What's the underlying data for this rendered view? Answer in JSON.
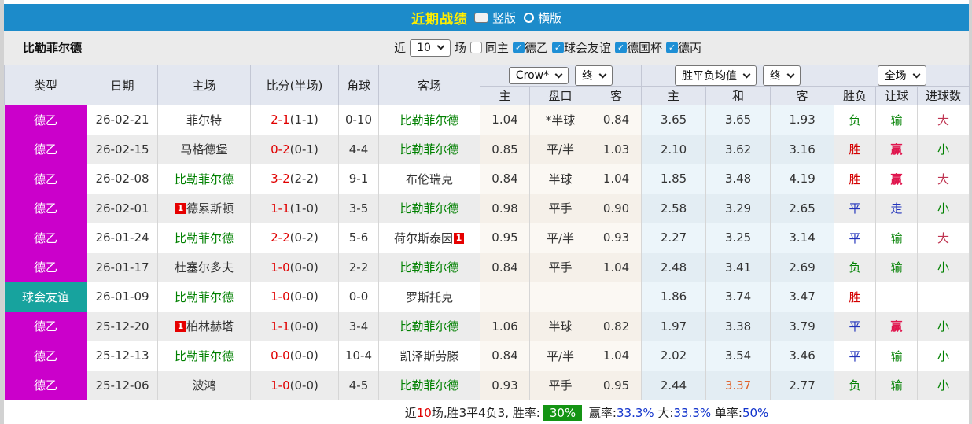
{
  "topbar": {
    "title": "近期战绩",
    "views": [
      {
        "label": "竖版",
        "selected": true
      },
      {
        "label": "横版",
        "selected": false
      }
    ]
  },
  "filterbar": {
    "team": "比勒菲尔德",
    "prefix": "近",
    "count": "10",
    "suffix": "场",
    "checkboxes": [
      {
        "label": "同主",
        "checked": false
      },
      {
        "label": "德乙",
        "checked": true
      },
      {
        "label": "球会友谊",
        "checked": true
      },
      {
        "label": "德国杯",
        "checked": true
      },
      {
        "label": "德丙",
        "checked": true
      }
    ]
  },
  "table": {
    "left_headers": [
      "类型",
      "日期",
      "主场",
      "比分(半场)",
      "角球",
      "客场"
    ],
    "odds_group": {
      "bookmaker": "Crow*",
      "period": "终",
      "cols": [
        "主",
        "盘口",
        "客"
      ]
    },
    "mean_group": {
      "label": "胜平负均值",
      "period": "终",
      "cols": [
        "主",
        "和",
        "客"
      ]
    },
    "result_group": {
      "scope": "全场",
      "cols": [
        "胜负",
        "让球",
        "进球数"
      ]
    },
    "badge_text": "1",
    "rows": [
      {
        "type": {
          "text": "德乙",
          "color": "#cb00cb"
        },
        "date": "26-02-21",
        "home": {
          "text": "菲尔特",
          "green": false,
          "badge": null
        },
        "score": [
          "2-1",
          "(1-1)"
        ],
        "corner": "0-10",
        "away": {
          "text": "比勒菲尔德",
          "green": true,
          "badge": null
        },
        "odds": [
          "1.04",
          "*半球",
          "0.84"
        ],
        "mean": [
          "3.65",
          "3.65",
          "1.93"
        ],
        "mean_hl": null,
        "outcome": {
          "t": "负",
          "c": "green"
        },
        "handicap": {
          "t": "输",
          "c": "green"
        },
        "goals": {
          "t": "大",
          "c": "rose"
        }
      },
      {
        "type": {
          "text": "德乙",
          "color": "#cb00cb"
        },
        "date": "26-02-15",
        "home": {
          "text": "马格德堡",
          "green": false,
          "badge": null
        },
        "score": [
          "0-2",
          "(0-1)"
        ],
        "corner": "4-4",
        "away": {
          "text": "比勒菲尔德",
          "green": true,
          "badge": null
        },
        "odds": [
          "0.85",
          "平/半",
          "1.03"
        ],
        "mean": [
          "2.10",
          "3.62",
          "3.16"
        ],
        "mean_hl": null,
        "outcome": {
          "t": "胜",
          "c": "red"
        },
        "handicap": {
          "t": "赢",
          "c": "crimson"
        },
        "goals": {
          "t": "小",
          "c": "green"
        }
      },
      {
        "type": {
          "text": "德乙",
          "color": "#cb00cb"
        },
        "date": "26-02-08",
        "home": {
          "text": "比勒菲尔德",
          "green": true,
          "badge": null
        },
        "score": [
          "3-2",
          "(2-2)"
        ],
        "corner": "9-1",
        "away": {
          "text": "布伦瑞克",
          "green": false,
          "badge": null
        },
        "odds": [
          "0.84",
          "半球",
          "1.04"
        ],
        "mean": [
          "1.85",
          "3.48",
          "4.19"
        ],
        "mean_hl": null,
        "outcome": {
          "t": "胜",
          "c": "red"
        },
        "handicap": {
          "t": "赢",
          "c": "crimson"
        },
        "goals": {
          "t": "大",
          "c": "rose"
        }
      },
      {
        "type": {
          "text": "德乙",
          "color": "#cb00cb"
        },
        "date": "26-02-01",
        "home": {
          "text": "德累斯顿",
          "green": false,
          "badge": "pre"
        },
        "score": [
          "1-1",
          "(1-0)"
        ],
        "corner": "3-5",
        "away": {
          "text": "比勒菲尔德",
          "green": true,
          "badge": null
        },
        "odds": [
          "0.98",
          "平手",
          "0.90"
        ],
        "mean": [
          "2.58",
          "3.29",
          "2.65"
        ],
        "mean_hl": null,
        "outcome": {
          "t": "平",
          "c": "blue"
        },
        "handicap": {
          "t": "走",
          "c": "blue"
        },
        "goals": {
          "t": "小",
          "c": "green"
        }
      },
      {
        "type": {
          "text": "德乙",
          "color": "#cb00cb"
        },
        "date": "26-01-24",
        "home": {
          "text": "比勒菲尔德",
          "green": true,
          "badge": null
        },
        "score": [
          "2-2",
          "(0-2)"
        ],
        "corner": "5-6",
        "away": {
          "text": "荷尔斯泰因",
          "green": false,
          "badge": "post"
        },
        "odds": [
          "0.95",
          "平/半",
          "0.93"
        ],
        "mean": [
          "2.27",
          "3.25",
          "3.14"
        ],
        "mean_hl": null,
        "outcome": {
          "t": "平",
          "c": "blue"
        },
        "handicap": {
          "t": "输",
          "c": "green"
        },
        "goals": {
          "t": "大",
          "c": "rose"
        }
      },
      {
        "type": {
          "text": "德乙",
          "color": "#cb00cb"
        },
        "date": "26-01-17",
        "home": {
          "text": "杜塞尔多夫",
          "green": false,
          "badge": null
        },
        "score": [
          "1-0",
          "(0-0)"
        ],
        "corner": "2-2",
        "away": {
          "text": "比勒菲尔德",
          "green": true,
          "badge": null
        },
        "odds": [
          "0.84",
          "平手",
          "1.04"
        ],
        "mean": [
          "2.48",
          "3.41",
          "2.69"
        ],
        "mean_hl": null,
        "outcome": {
          "t": "负",
          "c": "green"
        },
        "handicap": {
          "t": "输",
          "c": "green"
        },
        "goals": {
          "t": "小",
          "c": "green"
        }
      },
      {
        "type": {
          "text": "球会友谊",
          "color": "#17a39e"
        },
        "date": "26-01-09",
        "home": {
          "text": "比勒菲尔德",
          "green": true,
          "badge": null
        },
        "score": [
          "1-0",
          "(0-0)"
        ],
        "corner": "0-0",
        "away": {
          "text": "罗斯托克",
          "green": false,
          "badge": null
        },
        "odds": [
          "",
          "",
          ""
        ],
        "mean": [
          "1.86",
          "3.74",
          "3.47"
        ],
        "mean_hl": null,
        "outcome": {
          "t": "胜",
          "c": "red"
        },
        "handicap": {
          "t": "",
          "c": ""
        },
        "goals": {
          "t": "",
          "c": ""
        }
      },
      {
        "type": {
          "text": "德乙",
          "color": "#cb00cb"
        },
        "date": "25-12-20",
        "home": {
          "text": "柏林赫塔",
          "green": false,
          "badge": "pre"
        },
        "score": [
          "1-1",
          "(0-0)"
        ],
        "corner": "3-4",
        "away": {
          "text": "比勒菲尔德",
          "green": true,
          "badge": null
        },
        "odds": [
          "1.06",
          "半球",
          "0.82"
        ],
        "mean": [
          "1.97",
          "3.38",
          "3.79"
        ],
        "mean_hl": null,
        "outcome": {
          "t": "平",
          "c": "blue"
        },
        "handicap": {
          "t": "赢",
          "c": "crimson"
        },
        "goals": {
          "t": "小",
          "c": "green"
        }
      },
      {
        "type": {
          "text": "德乙",
          "color": "#cb00cb"
        },
        "date": "25-12-13",
        "home": {
          "text": "比勒菲尔德",
          "green": true,
          "badge": null
        },
        "score": [
          "0-0",
          "(0-0)"
        ],
        "corner": "10-4",
        "away": {
          "text": "凯泽斯劳滕",
          "green": false,
          "badge": null
        },
        "odds": [
          "0.84",
          "平/半",
          "1.04"
        ],
        "mean": [
          "2.02",
          "3.54",
          "3.46"
        ],
        "mean_hl": null,
        "outcome": {
          "t": "平",
          "c": "blue"
        },
        "handicap": {
          "t": "输",
          "c": "green"
        },
        "goals": {
          "t": "小",
          "c": "green"
        }
      },
      {
        "type": {
          "text": "德乙",
          "color": "#cb00cb"
        },
        "date": "25-12-06",
        "home": {
          "text": "波鸿",
          "green": false,
          "badge": null
        },
        "score": [
          "1-0",
          "(0-0)"
        ],
        "corner": "4-5",
        "away": {
          "text": "比勒菲尔德",
          "green": true,
          "badge": null
        },
        "odds": [
          "0.93",
          "平手",
          "0.95"
        ],
        "mean": [
          "2.44",
          "3.37",
          "2.77"
        ],
        "mean_hl": 1,
        "outcome": {
          "t": "负",
          "c": "green"
        },
        "handicap": {
          "t": "输",
          "c": "green"
        },
        "goals": {
          "t": "小",
          "c": "green"
        }
      }
    ]
  },
  "footer": {
    "segments": [
      {
        "t": "近"
      },
      {
        "t": "10",
        "c": "red"
      },
      {
        "t": "场,胜3平4负3, 胜率:"
      },
      {
        "t": "30%",
        "c": "badge"
      },
      {
        "t": " 赢率:"
      },
      {
        "t": "33.3%",
        "c": "blue"
      },
      {
        "t": " 大:"
      },
      {
        "t": "33.3%",
        "c": "blue"
      },
      {
        "t": " 单率:"
      },
      {
        "t": "50%",
        "c": "blue"
      }
    ]
  },
  "icons": {
    "check": "✓"
  },
  "colors": {
    "topbar": "#1c8bca",
    "league_de2": "#cb00cb",
    "club_friendly": "#17a39e",
    "win_rate_badge": "#149414"
  }
}
